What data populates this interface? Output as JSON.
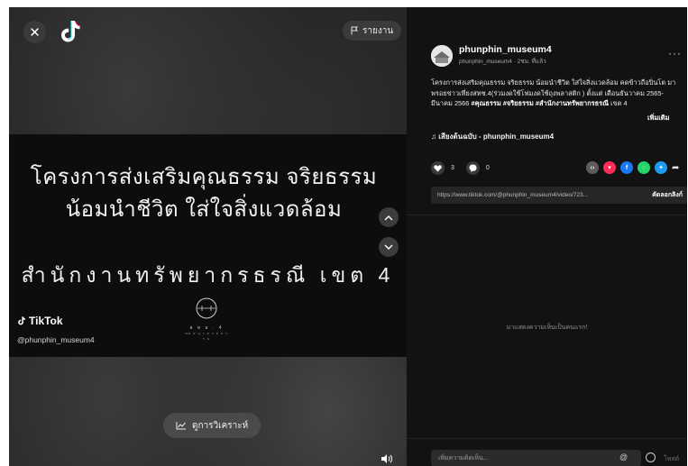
{
  "player": {
    "close_symbol": "✕",
    "report_label": "รายงาน",
    "title_line1": "โครงการส่งเสริมคุณธรรม จริยธรรม",
    "title_line2": "น้อมนำชีวิต ใส่ใจสิ่งแวดล้อม",
    "title_line3": "สำนักงานทรัพยากรธรณี เขต 4",
    "logo_caption": "ส ท ธ . 4",
    "logo_caption2": "ขต ๔ บุ ร ต ร ส ธ ร ร ม",
    "watermark_brand": "TikTok",
    "watermark_handle": "@phunphin_museum4",
    "analytics_label": "ดูการวิเคราะห์",
    "icons": [
      "close-icon",
      "tiktok-logo-icon",
      "flag-icon",
      "chevron-up-icon",
      "chevron-down-icon",
      "analytics-icon",
      "volume-icon"
    ]
  },
  "post": {
    "username": "phunphin_museum4",
    "meta": "phunphin_museum4 · 2ชม. ที่แล้ว",
    "caption_part1": "โครงการส่งเสริมคุณธรรม จริยธรรม น้อมนำชีวิต ใส่ใจสิ่งแวดล้อม คดข้าวถือปิ่นโต มาพรอยข่าวเที่ยงสทช.4(ร่วมงดใช้โฟมงดใช้ถุงพลาสติก ) ตั้งแต่ เดือนธันวาคม 2565-มีนาคม 2566 ",
    "caption_tag1": "#คุณธรรม",
    "caption_tag2": "#จริยธรรม",
    "caption_tag3": "#สำนักงานทรัพยากรธรณี",
    "caption_tail": " เขต 4",
    "see_more": "เพิ่มเติม",
    "sound": "♫ เสียงต้นฉบับ - phunphin_museum4",
    "likes": "3",
    "comments": "0",
    "link": "https://www.tiktok.com/@phunphin_museum4/video/723...",
    "copy_link": "คัดลอกลิงก์",
    "empty_comments": "มาแสดงความเห็นเป็นคนแรก!",
    "comment_placeholder": "เพิ่มความคิดเห็น...",
    "at_symbol": "@",
    "post_label": "โพสต์",
    "colors": {
      "background": "#121212",
      "embed": "#5d5d5d",
      "tiktok_red": "#fe2c55",
      "facebook": "#1877f2",
      "whatsapp": "#25d366",
      "twitter": "#1d9bf0"
    }
  }
}
